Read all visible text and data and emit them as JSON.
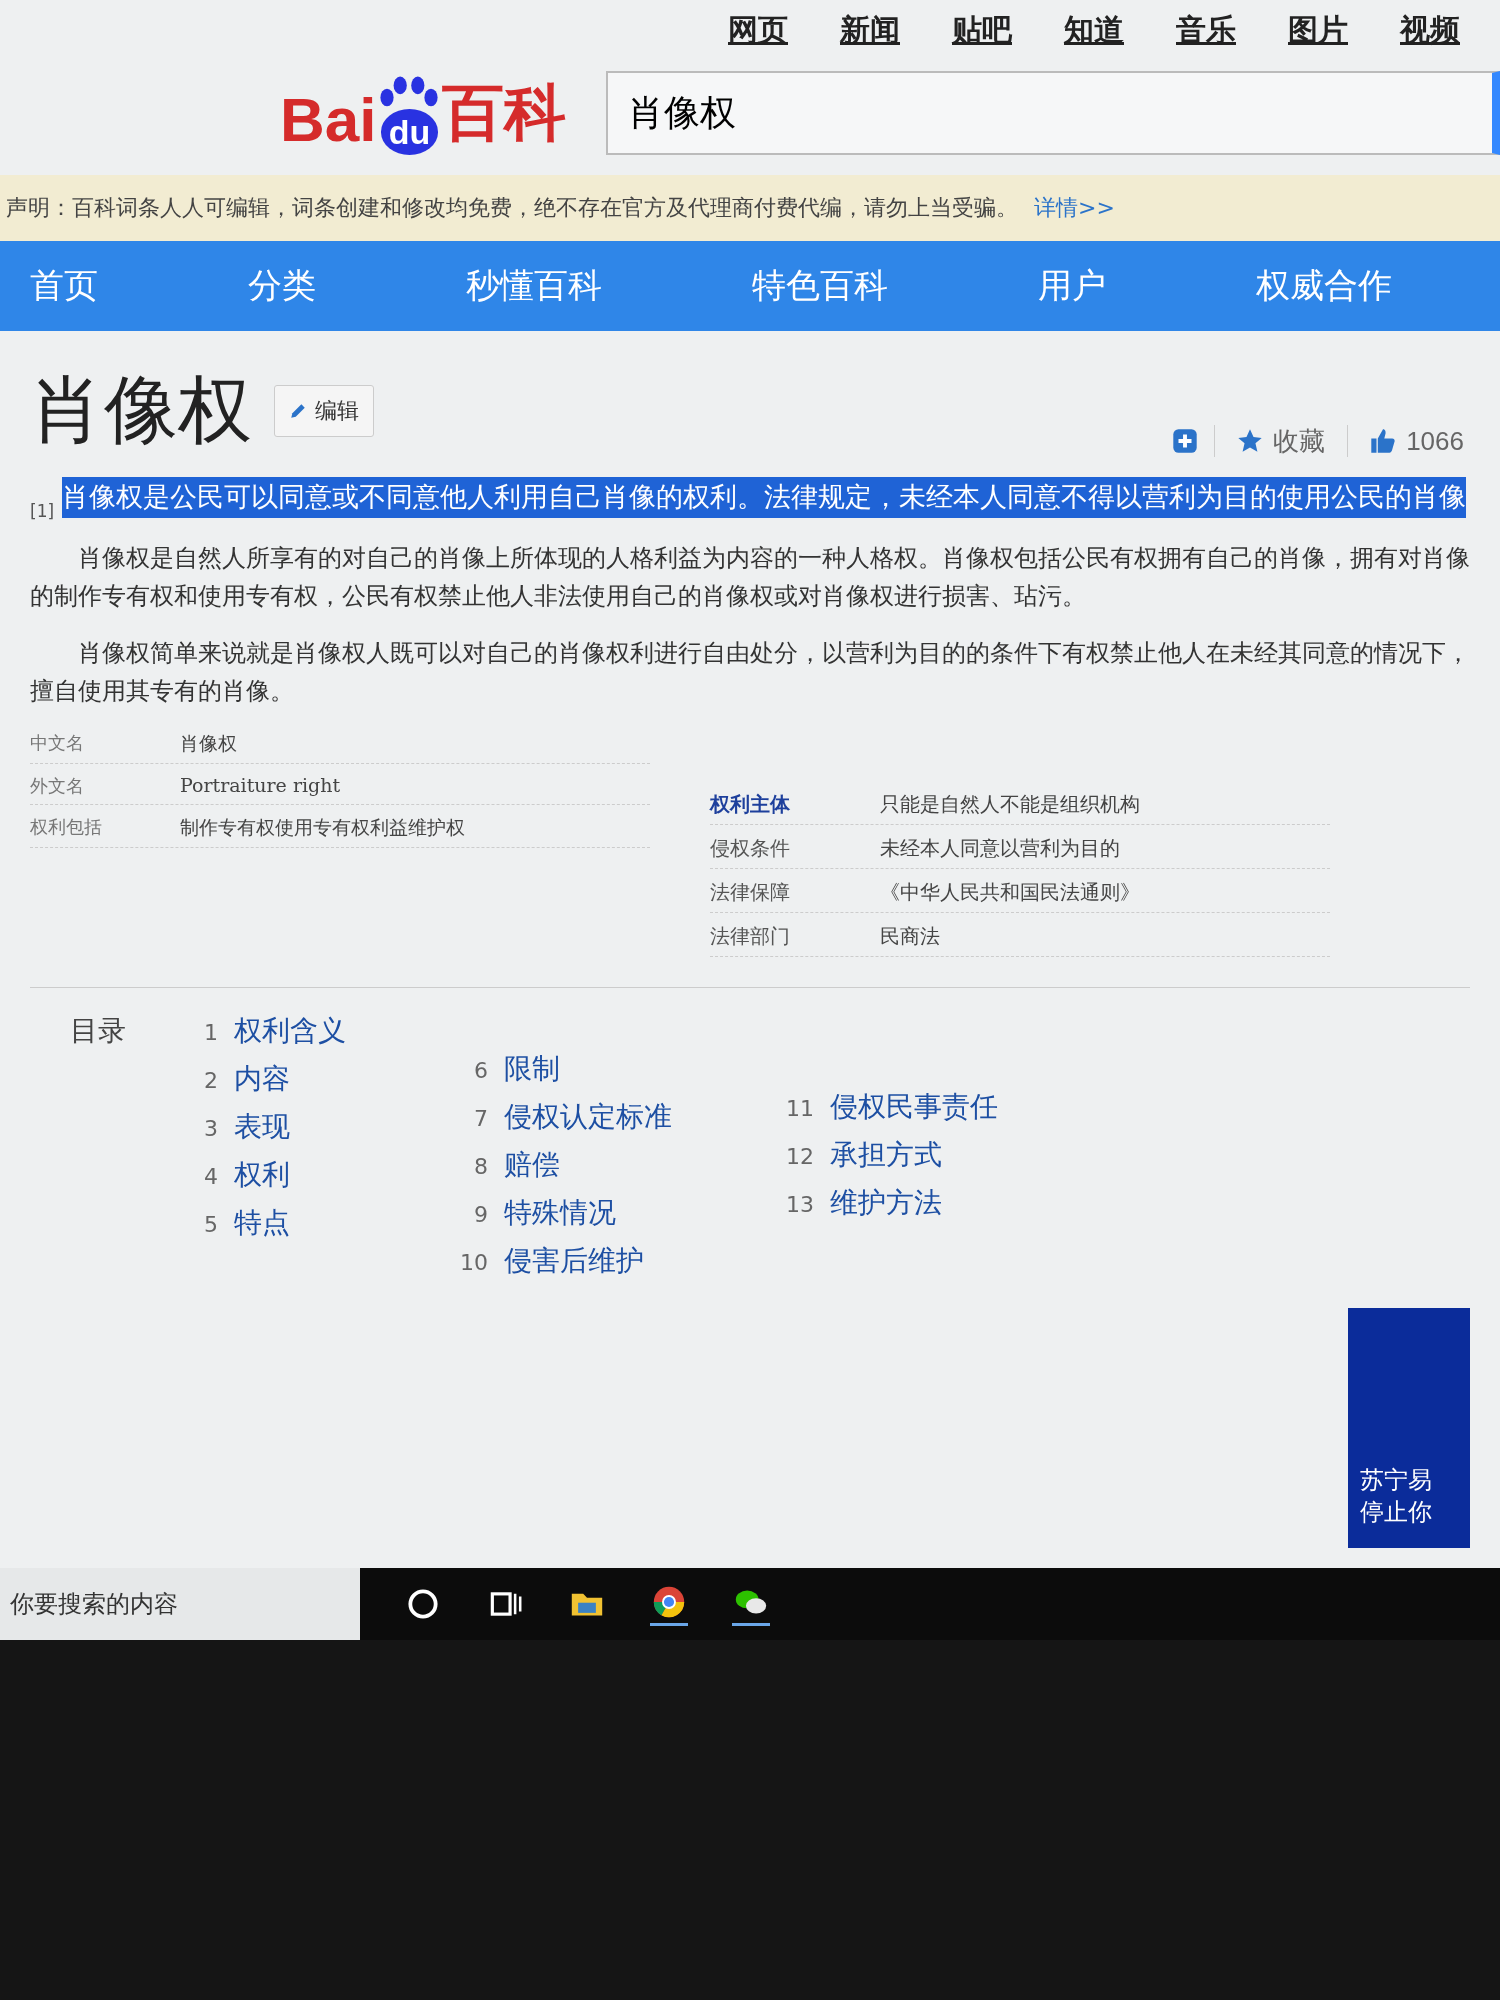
{
  "top_links": [
    "网页",
    "新闻",
    "贴吧",
    "知道",
    "音乐",
    "图片",
    "视频"
  ],
  "logo": {
    "left": "Bai",
    "badge": "du",
    "right": "百科"
  },
  "search": {
    "value": "肖像权"
  },
  "notice": {
    "text": "声明：百科词条人人可编辑，词条创建和修改均免费，绝不存在官方及代理商付费代编，请勿上当受骗。",
    "link": "详情>>"
  },
  "nav": [
    "首页",
    "分类",
    "秒懂百科",
    "特色百科",
    "用户",
    "权威合作"
  ],
  "article": {
    "title": "肖像权",
    "edit": "编辑",
    "favorite": "收藏",
    "likes": "1066",
    "summary": {
      "text": "肖像权是公民可以同意或不同意他人利用自己肖像的权利。法律规定，未经本人同意不得以营利为目的使用公民的肖像",
      "highlighted": true,
      "ref": "[1]"
    },
    "paragraphs": [
      "肖像权是自然人所享有的对自己的肖像上所体现的人格利益为内容的一种人格权。肖像权包括公民有权拥有自己的肖像，拥有对肖像的制作专有权和使用专有权，公民有权禁止他人非法使用自己的肖像权或对肖像权进行损害、玷污。",
      "肖像权简单来说就是肖像权人既可以对自己的肖像权利进行自由处分，以营利为目的的条件下有权禁止他人在未经其同意的情况下，擅自使用其专有的肖像。"
    ]
  },
  "infobox": {
    "left": [
      {
        "label": "中文名",
        "value": "肖像权",
        "link": false
      },
      {
        "label": "外文名",
        "value": "Portraiture right",
        "link": false
      },
      {
        "label": "权利包括",
        "value": "制作专有权使用专有权利益维护权",
        "link": false
      }
    ],
    "right": [
      {
        "label": "权利主体",
        "value": "只能是自然人不能是组织机构",
        "link": true
      },
      {
        "label": "侵权条件",
        "value": "未经本人同意以营利为目的",
        "link": false
      },
      {
        "label": "法律保障",
        "value": "《中华人民共和国民法通则》",
        "link": false
      },
      {
        "label": "法律部门",
        "value": "民商法",
        "link": false
      }
    ]
  },
  "toc": {
    "heading": "目录",
    "columns": [
      [
        {
          "num": "1",
          "text": "权利含义"
        },
        {
          "num": "2",
          "text": "内容"
        },
        {
          "num": "3",
          "text": "表现"
        },
        {
          "num": "4",
          "text": "权利"
        },
        {
          "num": "5",
          "text": "特点"
        }
      ],
      [
        {
          "num": "6",
          "text": "限制"
        },
        {
          "num": "7",
          "text": "侵权认定标准"
        },
        {
          "num": "8",
          "text": "赔偿"
        },
        {
          "num": "9",
          "text": "特殊情况"
        },
        {
          "num": "10",
          "text": "侵害后维护"
        }
      ],
      [
        {
          "num": "11",
          "text": "侵权民事责任"
        },
        {
          "num": "12",
          "text": "承担方式"
        },
        {
          "num": "13",
          "text": "维护方法"
        }
      ]
    ]
  },
  "ad": {
    "lines": [
      "苏宁易",
      "停止你"
    ]
  },
  "taskbar": {
    "search_placeholder": "你要搜索的内容"
  }
}
